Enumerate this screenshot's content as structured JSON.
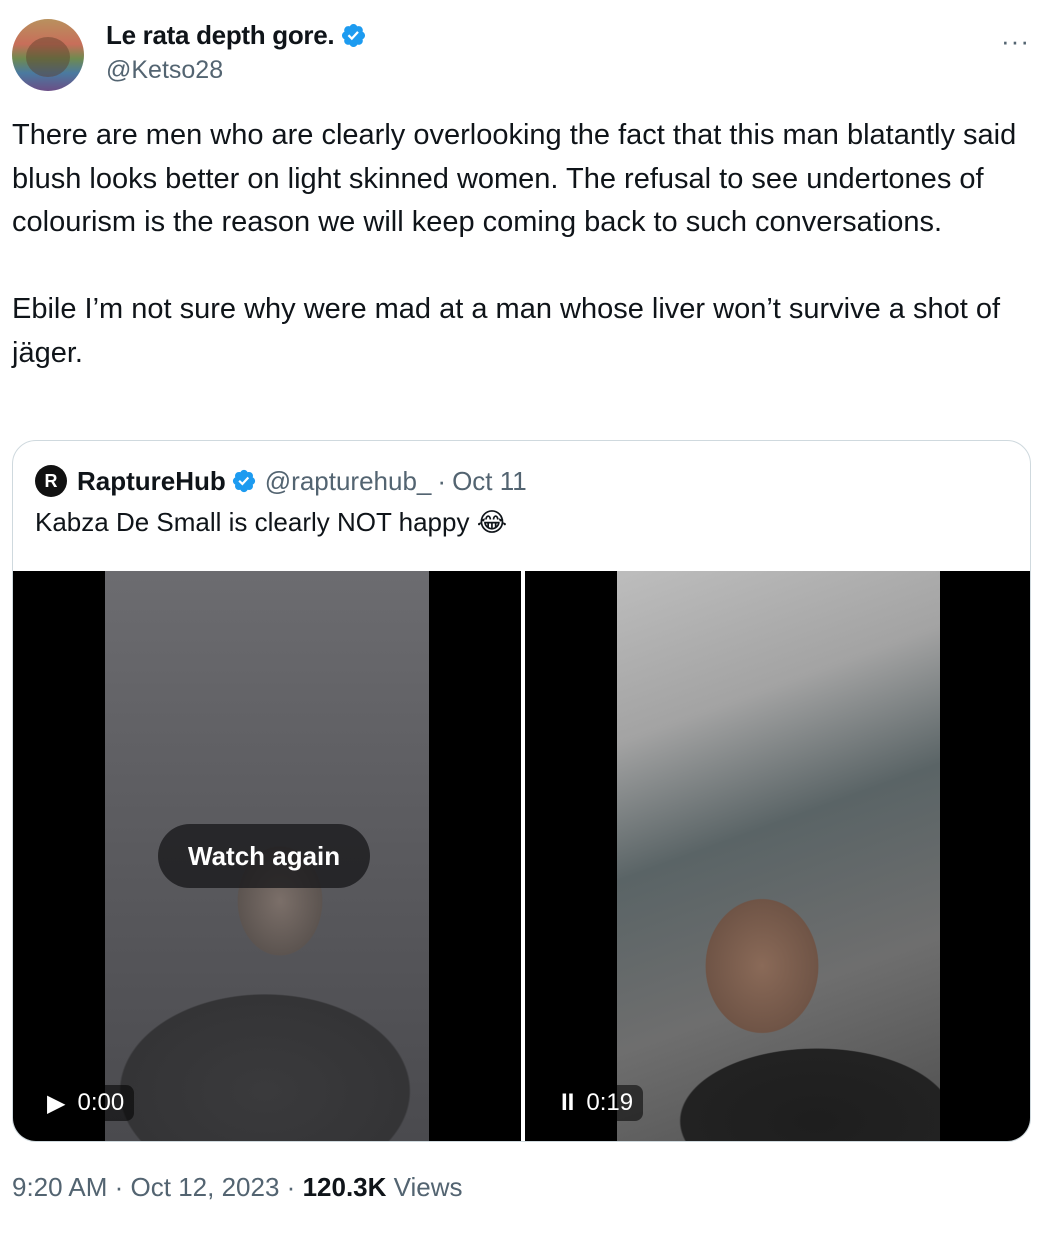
{
  "author": {
    "display_name": "Le rata depth gore.",
    "handle": "@Ketso28",
    "verified": true
  },
  "menu": {
    "more_label": "···"
  },
  "tweet": {
    "text": "There are men who are clearly overlooking the fact that this man blatantly said blush looks better on light skinned women. The refusal to see undertones of colourism is the reason we will keep coming back to such conversations.\n\nEbile I’m not sure why were mad at a man whose liver won’t survive a shot of jäger."
  },
  "quote": {
    "display_name": "RaptureHub",
    "handle": "@rapturehub_",
    "separator": "·",
    "date": "Oct 11",
    "text": "Kabza De Small is clearly NOT happy 😂",
    "avatar_glyph": "R",
    "media": [
      {
        "state": "ended",
        "overlay_label": "Watch again",
        "control_icon": "play-icon",
        "control_glyph": "▶",
        "time": "0:00"
      },
      {
        "state": "playing",
        "control_icon": "pause-icon",
        "control_glyph": "II",
        "time": "0:19"
      }
    ]
  },
  "meta": {
    "time": "9:20 AM",
    "separator": "·",
    "date": "Oct 12, 2023",
    "views_count": "120.3K",
    "views_label": "Views"
  },
  "colors": {
    "verified_badge": "#1d9bf0",
    "text_primary": "#0f1419",
    "text_secondary": "#536471",
    "border": "#cfd9de"
  }
}
